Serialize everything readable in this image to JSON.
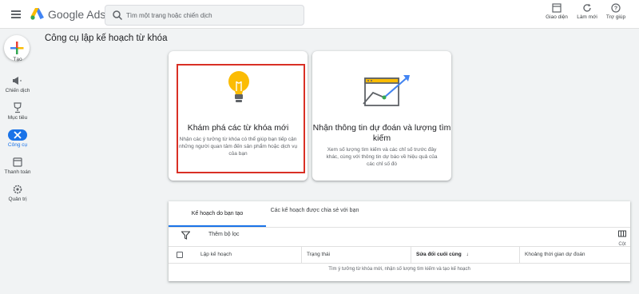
{
  "header": {
    "brand": "Google Ads",
    "search_placeholder": "Tìm một trang hoặc chiến dịch",
    "actions": [
      {
        "label": "Giao diện",
        "icon": "appearance-icon"
      },
      {
        "label": "Làm mới",
        "icon": "refresh-icon"
      },
      {
        "label": "Trợ giúp",
        "icon": "help-icon"
      }
    ]
  },
  "sidebar": {
    "create_label": "Tạo",
    "items": [
      {
        "label": "Chiến dịch",
        "icon": "megaphone-icon",
        "active": false
      },
      {
        "label": "Mục tiêu",
        "icon": "trophy-icon",
        "active": false
      },
      {
        "label": "Công cụ",
        "icon": "tools-icon",
        "active": true
      },
      {
        "label": "Thanh toán",
        "icon": "credit-card-icon",
        "active": false
      },
      {
        "label": "Quản trị",
        "icon": "gear-icon",
        "active": false
      }
    ]
  },
  "page": {
    "title": "Công cụ lập kế hoạch từ khóa"
  },
  "cards": [
    {
      "title": "Khám phá các từ khóa mới",
      "description": "Nhận các ý tưởng từ khóa có thể giúp bạn tiếp cận những người quan tâm đến sản phẩm hoặc dịch vụ của bạn",
      "icon": "lightbulb-icon",
      "highlighted": true
    },
    {
      "title": "Nhận thông tin dự đoán và lượng tìm kiếm",
      "description": "Xem số lượng tìm kiếm và các chỉ số trước đây khác, cùng với thông tin dự báo về hiệu quả của các chỉ số đó",
      "icon": "forecast-chart-icon",
      "highlighted": false
    }
  ],
  "plans": {
    "tabs": [
      {
        "label": "Kế hoạch do bạn tạo",
        "active": true
      },
      {
        "label": "Các kế hoạch được chia sẻ với bạn",
        "active": false
      }
    ],
    "filter_label": "Thêm bộ lọc",
    "columns_label": "Cột",
    "table_headers": [
      "Lập kế hoạch",
      "Trạng thái",
      "Sửa đổi cuối cùng",
      "Khoảng thời gian dự đoán"
    ],
    "empty_message": "Tìm ý tưởng từ khóa mới, nhận số lượng tìm kiếm và tạo kế hoạch"
  },
  "colors": {
    "accent": "#1a73e8",
    "highlight_border": "#d93025",
    "bulb": "#fbbc04"
  }
}
